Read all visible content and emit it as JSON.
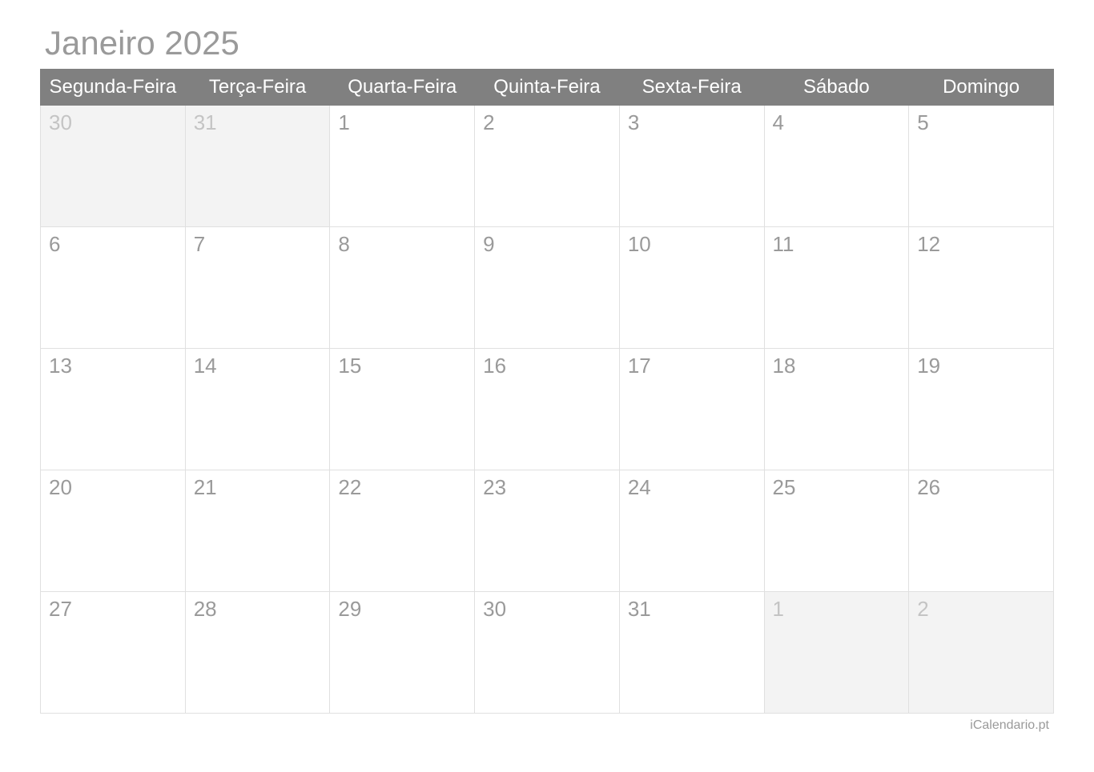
{
  "title": "Janeiro 2025",
  "weekdays": [
    "Segunda-Feira",
    "Terça-Feira",
    "Quarta-Feira",
    "Quinta-Feira",
    "Sexta-Feira",
    "Sábado",
    "Domingo"
  ],
  "weeks": [
    [
      {
        "day": "30",
        "other": true
      },
      {
        "day": "31",
        "other": true
      },
      {
        "day": "1",
        "other": false
      },
      {
        "day": "2",
        "other": false
      },
      {
        "day": "3",
        "other": false
      },
      {
        "day": "4",
        "other": false
      },
      {
        "day": "5",
        "other": false
      }
    ],
    [
      {
        "day": "6",
        "other": false
      },
      {
        "day": "7",
        "other": false
      },
      {
        "day": "8",
        "other": false
      },
      {
        "day": "9",
        "other": false
      },
      {
        "day": "10",
        "other": false
      },
      {
        "day": "11",
        "other": false
      },
      {
        "day": "12",
        "other": false
      }
    ],
    [
      {
        "day": "13",
        "other": false
      },
      {
        "day": "14",
        "other": false
      },
      {
        "day": "15",
        "other": false
      },
      {
        "day": "16",
        "other": false
      },
      {
        "day": "17",
        "other": false
      },
      {
        "day": "18",
        "other": false
      },
      {
        "day": "19",
        "other": false
      }
    ],
    [
      {
        "day": "20",
        "other": false
      },
      {
        "day": "21",
        "other": false
      },
      {
        "day": "22",
        "other": false
      },
      {
        "day": "23",
        "other": false
      },
      {
        "day": "24",
        "other": false
      },
      {
        "day": "25",
        "other": false
      },
      {
        "day": "26",
        "other": false
      }
    ],
    [
      {
        "day": "27",
        "other": false
      },
      {
        "day": "28",
        "other": false
      },
      {
        "day": "29",
        "other": false
      },
      {
        "day": "30",
        "other": false
      },
      {
        "day": "31",
        "other": false
      },
      {
        "day": "1",
        "other": true
      },
      {
        "day": "2",
        "other": true
      }
    ]
  ],
  "footer": "iCalendario.pt"
}
